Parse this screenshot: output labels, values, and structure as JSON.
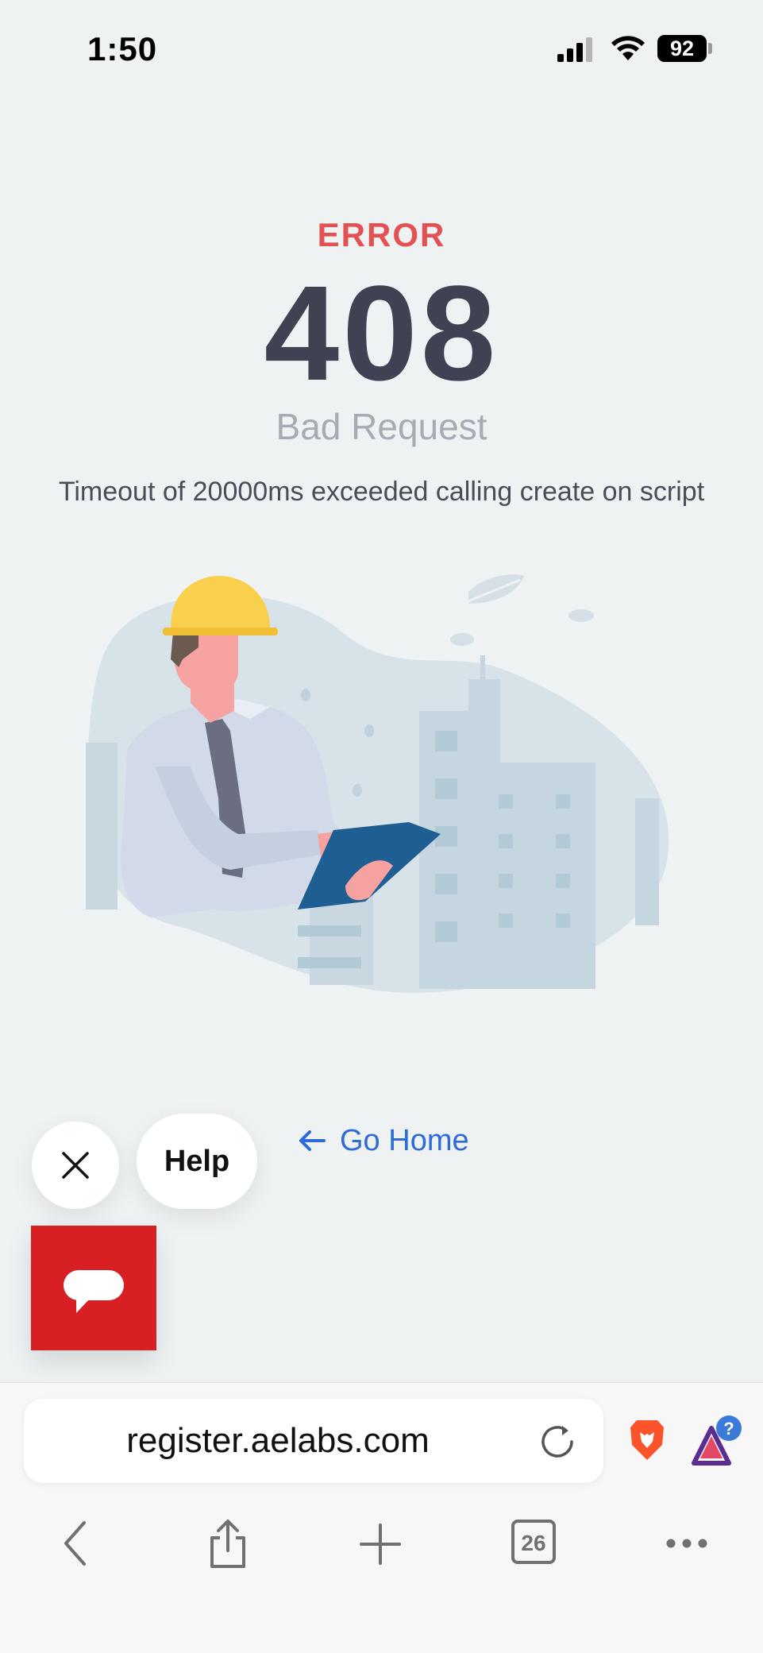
{
  "status_bar": {
    "time": "1:50",
    "battery": "92"
  },
  "error": {
    "label": "ERROR",
    "code": "408",
    "title": "Bad Request",
    "message": "Timeout of 20000ms exceeded calling create on script"
  },
  "go_home": {
    "label": "Go Home"
  },
  "help_widget": {
    "help_label": "Help"
  },
  "browser": {
    "url": "register.aelabs.com",
    "tab_count": "26",
    "rewards_badge": "?"
  },
  "colors": {
    "error_red": "#e25252",
    "code_dark": "#3e4252",
    "link_blue": "#2e6bd6",
    "chat_red": "#d82024"
  }
}
